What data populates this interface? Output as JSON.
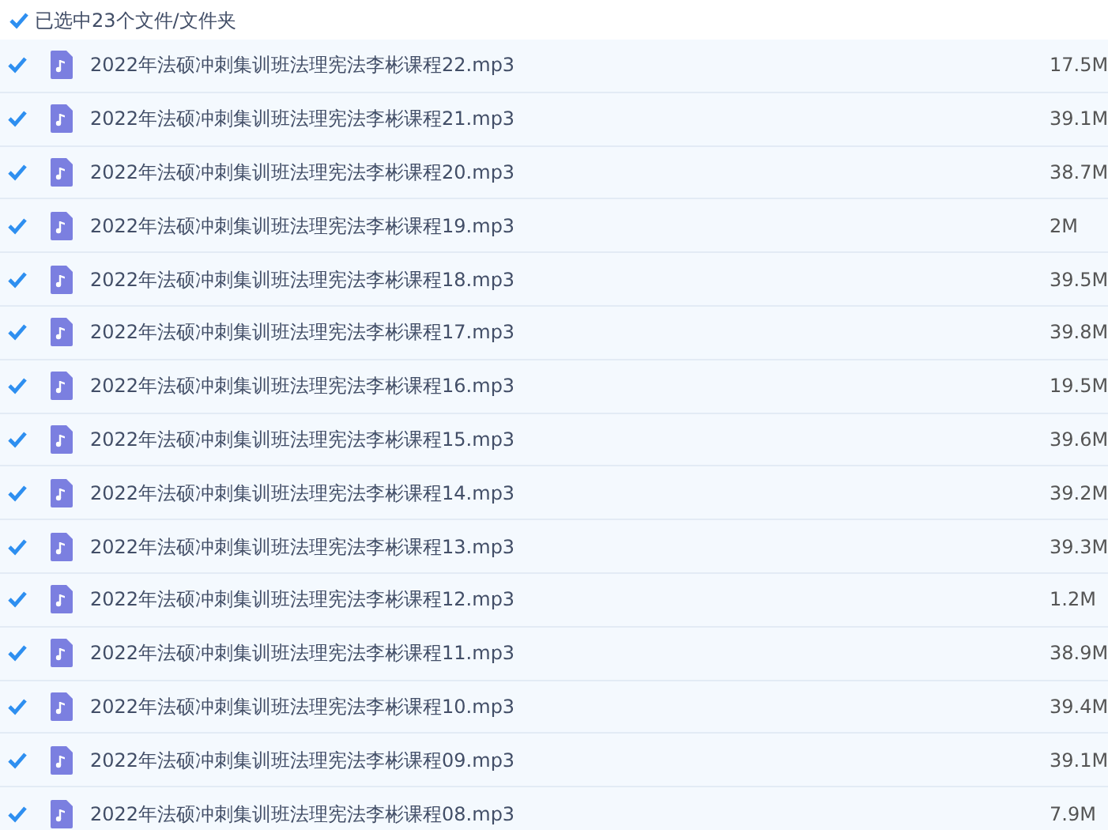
{
  "header": {
    "label": "已选中23个文件/文件夹",
    "checked": true
  },
  "files": [
    {
      "name": "2022年法硕冲刺集训班法理宪法李彬课程22.mp3",
      "size": "17.5M",
      "checked": true
    },
    {
      "name": "2022年法硕冲刺集训班法理宪法李彬课程21.mp3",
      "size": "39.1M",
      "checked": true
    },
    {
      "name": "2022年法硕冲刺集训班法理宪法李彬课程20.mp3",
      "size": "38.7M",
      "checked": true
    },
    {
      "name": "2022年法硕冲刺集训班法理宪法李彬课程19.mp3",
      "size": "2M",
      "checked": true
    },
    {
      "name": "2022年法硕冲刺集训班法理宪法李彬课程18.mp3",
      "size": "39.5M",
      "checked": true
    },
    {
      "name": "2022年法硕冲刺集训班法理宪法李彬课程17.mp3",
      "size": "39.8M",
      "checked": true
    },
    {
      "name": "2022年法硕冲刺集训班法理宪法李彬课程16.mp3",
      "size": "19.5M",
      "checked": true
    },
    {
      "name": "2022年法硕冲刺集训班法理宪法李彬课程15.mp3",
      "size": "39.6M",
      "checked": true
    },
    {
      "name": "2022年法硕冲刺集训班法理宪法李彬课程14.mp3",
      "size": "39.2M",
      "checked": true
    },
    {
      "name": "2022年法硕冲刺集训班法理宪法李彬课程13.mp3",
      "size": "39.3M",
      "checked": true
    },
    {
      "name": "2022年法硕冲刺集训班法理宪法李彬课程12.mp3",
      "size": "1.2M",
      "checked": true
    },
    {
      "name": "2022年法硕冲刺集训班法理宪法李彬课程11.mp3",
      "size": "38.9M",
      "checked": true
    },
    {
      "name": "2022年法硕冲刺集训班法理宪法李彬课程10.mp3",
      "size": "39.4M",
      "checked": true
    },
    {
      "name": "2022年法硕冲刺集训班法理宪法李彬课程09.mp3",
      "size": "39.1M",
      "checked": true
    },
    {
      "name": "2022年法硕冲刺集训班法理宪法李彬课程08.mp3",
      "size": "7.9M",
      "checked": true
    }
  ]
}
